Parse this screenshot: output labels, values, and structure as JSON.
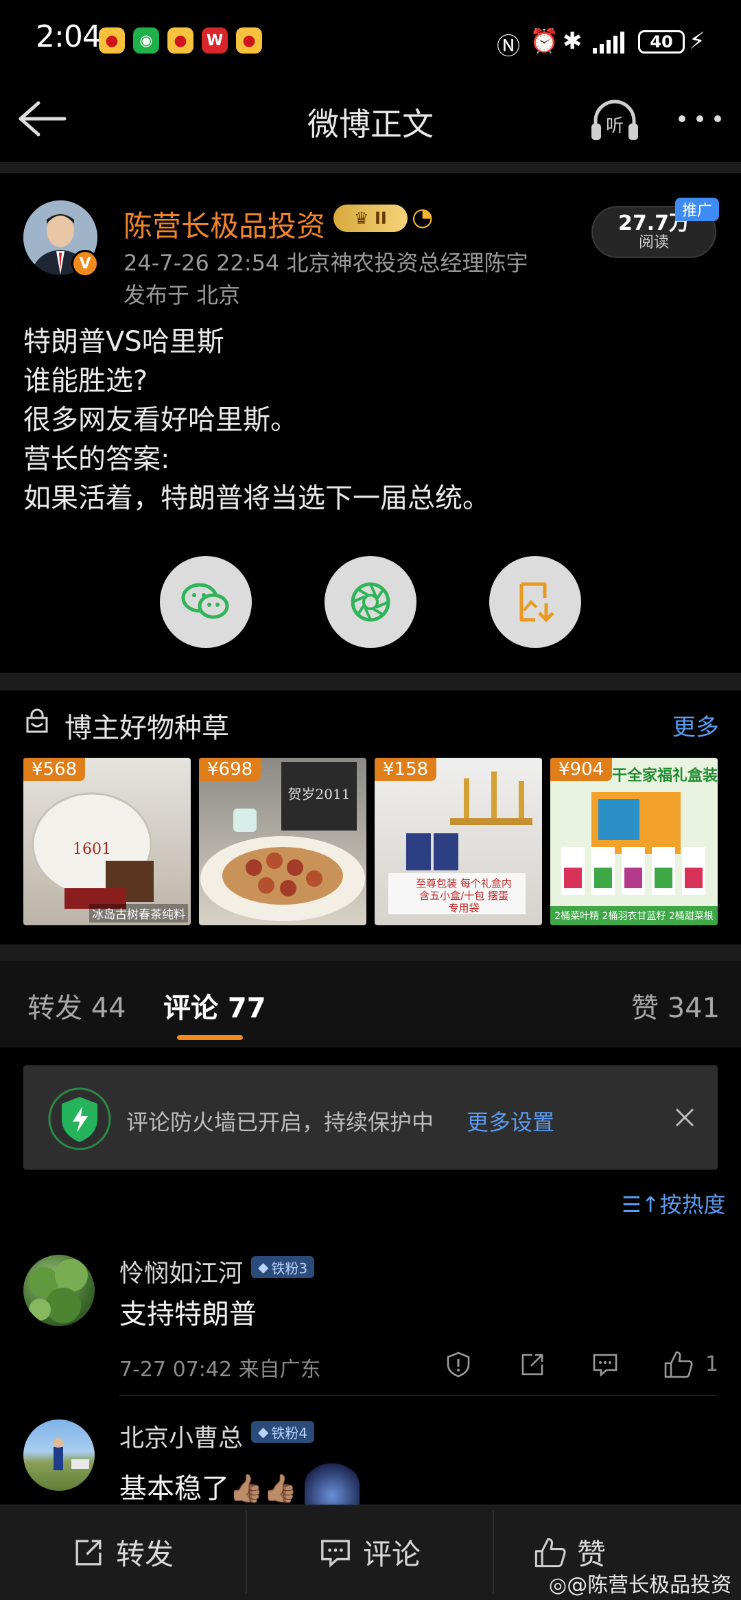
{
  "status_bar": {
    "time": "2:04",
    "battery": "40",
    "notification_icons": [
      "weibo-icon",
      "wechat-icon",
      "weibo-icon",
      "wps-icon",
      "weibo-icon"
    ],
    "system_icons": [
      "nfc-icon",
      "alarm-icon",
      "bluetooth-icon",
      "signal-icon",
      "charging-icon"
    ]
  },
  "navbar": {
    "title": "微博正文",
    "listen_label": "听"
  },
  "post": {
    "author": {
      "name": "陈营长极品投资",
      "level": "II",
      "verified_mark": "V"
    },
    "meta": "24-7-26 22:54  北京神农投资总经理陈宇",
    "location": "发布于 北京",
    "reads": {
      "count": "27.7万",
      "label": "阅读"
    },
    "promo_tag": "推广",
    "body_lines": [
      "特朗普VS哈里斯",
      "谁能胜选?",
      "很多网友看好哈里斯。",
      "营长的答案:",
      "如果活着，特朗普将当选下一届总统。"
    ]
  },
  "share_buttons": [
    "wechat-share-icon",
    "moments-share-icon",
    "save-image-icon"
  ],
  "goods": {
    "title": "博主好物种草",
    "more": "更多",
    "items": [
      {
        "price": "¥568",
        "caption": "冰岛古树春茶纯料",
        "stamp": "1601"
      },
      {
        "price": "¥698",
        "caption": "",
        "stamp": "贺岁2011"
      },
      {
        "price": "¥158",
        "caption": "至尊包装 每个礼盒内含五小盒/十包 摆蛋专用袋",
        "stamp": ""
      },
      {
        "price": "¥904",
        "caption": "2桶菜叶精 2桶羽衣甘蓝籽 2桶甜菜根",
        "stamp": "干全家福礼盒装"
      }
    ]
  },
  "tabs": {
    "repost": "转发 44",
    "comment": "评论 77",
    "like": "赞 341"
  },
  "firewall": {
    "text": "评论防火墙已开启，持续保护中",
    "settings": "更多设置"
  },
  "sort_label": "按热度",
  "comments": [
    {
      "name": "怜悯如江河",
      "badge": "铁粉3",
      "text": "支持特朗普",
      "meta": "7-27 07:42  来自广东",
      "likes": "1"
    },
    {
      "name": "北京小曹总",
      "badge": "铁粉4",
      "text": "基本稳了👍🏽👍🏽",
      "meta": "",
      "likes": ""
    }
  ],
  "bottom_bar": {
    "repost": "转发",
    "comment": "评论",
    "like": "赞"
  },
  "watermark": "@陈营长极品投资",
  "colors": {
    "background": "#000000",
    "accent_orange": "#f28a1c",
    "link_blue": "#5b9bf0",
    "author_orange": "#f0852a"
  }
}
